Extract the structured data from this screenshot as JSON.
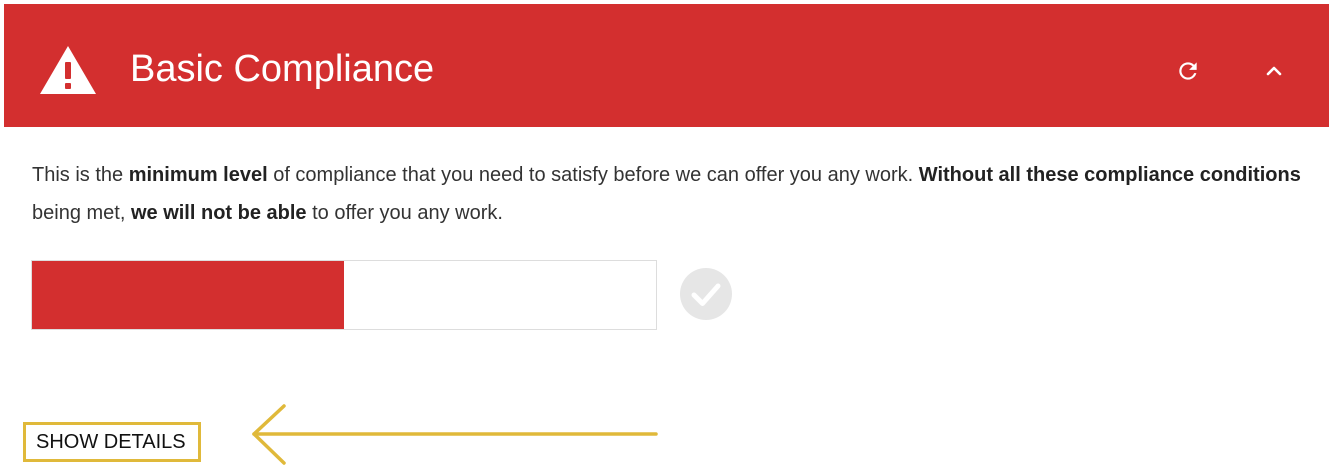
{
  "panel": {
    "title": "Basic Compliance",
    "header_color": "#d32f2f",
    "icons": {
      "status": "warning-triangle-icon",
      "refresh": "refresh-icon",
      "collapse": "chevron-up-icon"
    }
  },
  "description": {
    "parts": [
      {
        "text": "This is the ",
        "bold": false
      },
      {
        "text": "minimum level",
        "bold": true
      },
      {
        "text": " of compliance that you need to satisfy before we can offer you any work. ",
        "bold": false
      },
      {
        "text": "Without all these compliance conditions",
        "bold": true
      },
      {
        "text": " being met, ",
        "bold": false
      },
      {
        "text": "we will not be able",
        "bold": true
      },
      {
        "text": " to offer you any work.",
        "bold": false
      }
    ]
  },
  "progress": {
    "value": 0.5,
    "fill_color": "#d32f2f",
    "complete_icon": "check-circle-icon"
  },
  "actions": {
    "show_details_label": "SHOW DETAILS"
  },
  "annotation": {
    "highlight_color": "#e0b93a",
    "arrow_icon": "arrow-left-icon"
  }
}
